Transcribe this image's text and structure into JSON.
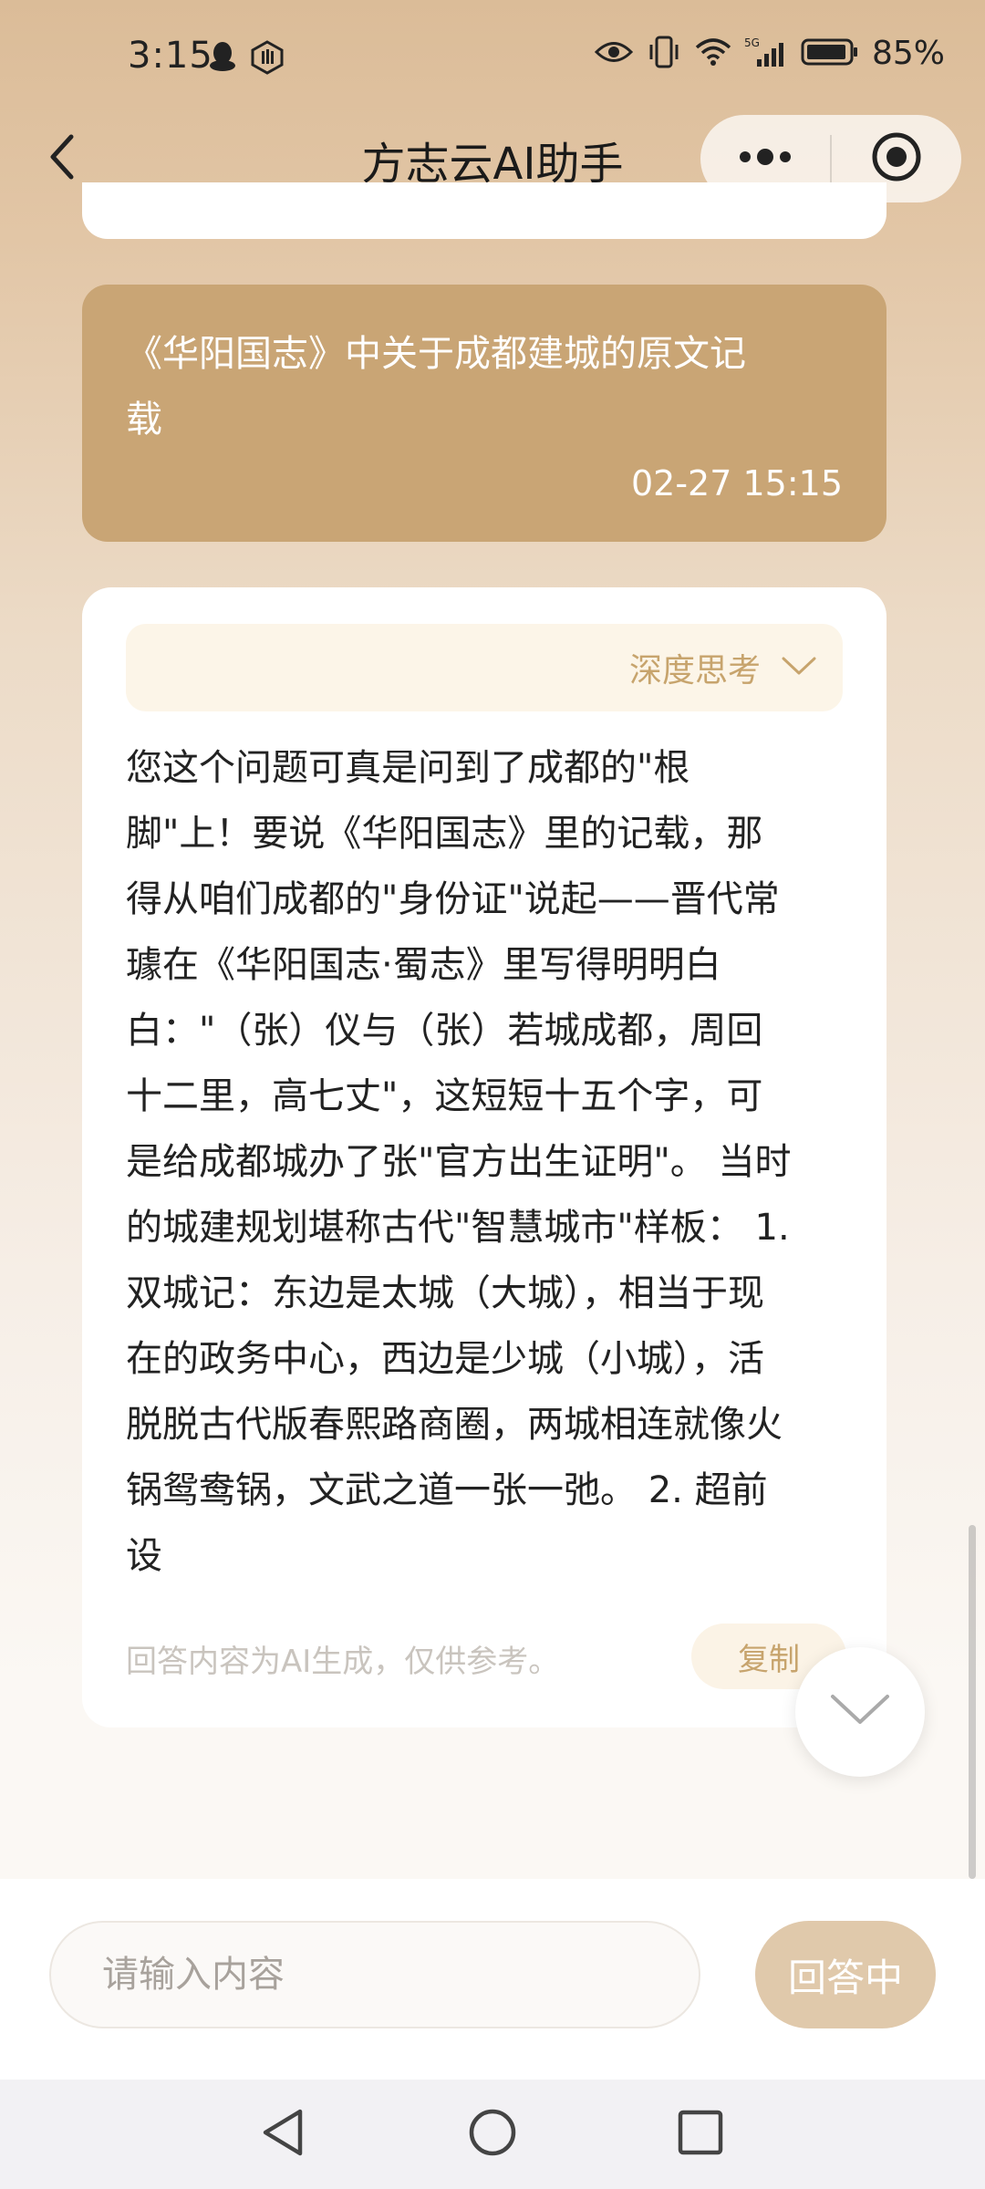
{
  "status_bar": {
    "time": "3:15",
    "left_icons": [
      "qq-icon",
      "hand-icon"
    ],
    "right_icons": [
      "eye-icon",
      "vibrate-icon",
      "wifi-icon",
      "signal-5g-icon",
      "battery-icon"
    ],
    "network_label": "5G",
    "battery_text": "85%"
  },
  "header": {
    "title": "方志云AI助手",
    "back_icon": "chevron-left-icon",
    "more_icon": "more-dots-icon",
    "close_icon": "target-close-icon"
  },
  "question": {
    "text": "《华阳国志》中关于成都建城的原文记载",
    "lines": [
      "《华阳国志》中关于成都建城的原文记",
      "载"
    ],
    "time": "02-27 15:15"
  },
  "answer": {
    "think_label": "深度思考",
    "think_icon": "chevron-down-icon",
    "lines": [
      "您这个问题可真是问到了成都的\"根",
      "脚\"上！要说《华阳国志》里的记载，那",
      "得从咱们成都的\"身份证\"说起——晋代常",
      "璩在《华阳国志·蜀志》里写得明明白",
      "白：\"（张）仪与（张）若城成都，周回",
      "十二里，高七丈\"，这短短十五个字，可",
      "是给成都城办了张\"官方出生证明\"。 当时",
      "的城建规划堪称古代\"智慧城市\"样板： 1.",
      "双城记：东边是太城（大城），相当于现",
      "在的政务中心，西边是少城（小城），活",
      "脱脱古代版春熙路商圈，两城相连就像火",
      "锅鸳鸯锅，文武之道一张一弛。 2. 超前",
      "设"
    ],
    "disclaimer": "回答内容为AI生成，仅供参考。",
    "copy_label": "复制"
  },
  "input": {
    "placeholder": "请输入内容",
    "value": "",
    "submit_label": "回答中"
  },
  "nav": {
    "back_icon": "nav-back-icon",
    "home_icon": "nav-home-icon",
    "recents_icon": "nav-recents-icon"
  },
  "colors": {
    "accent": "#c9a575",
    "accent_light": "#fcf5e8",
    "accent_text": "#c7a46d",
    "submit_bg": "#e0c9ab"
  }
}
